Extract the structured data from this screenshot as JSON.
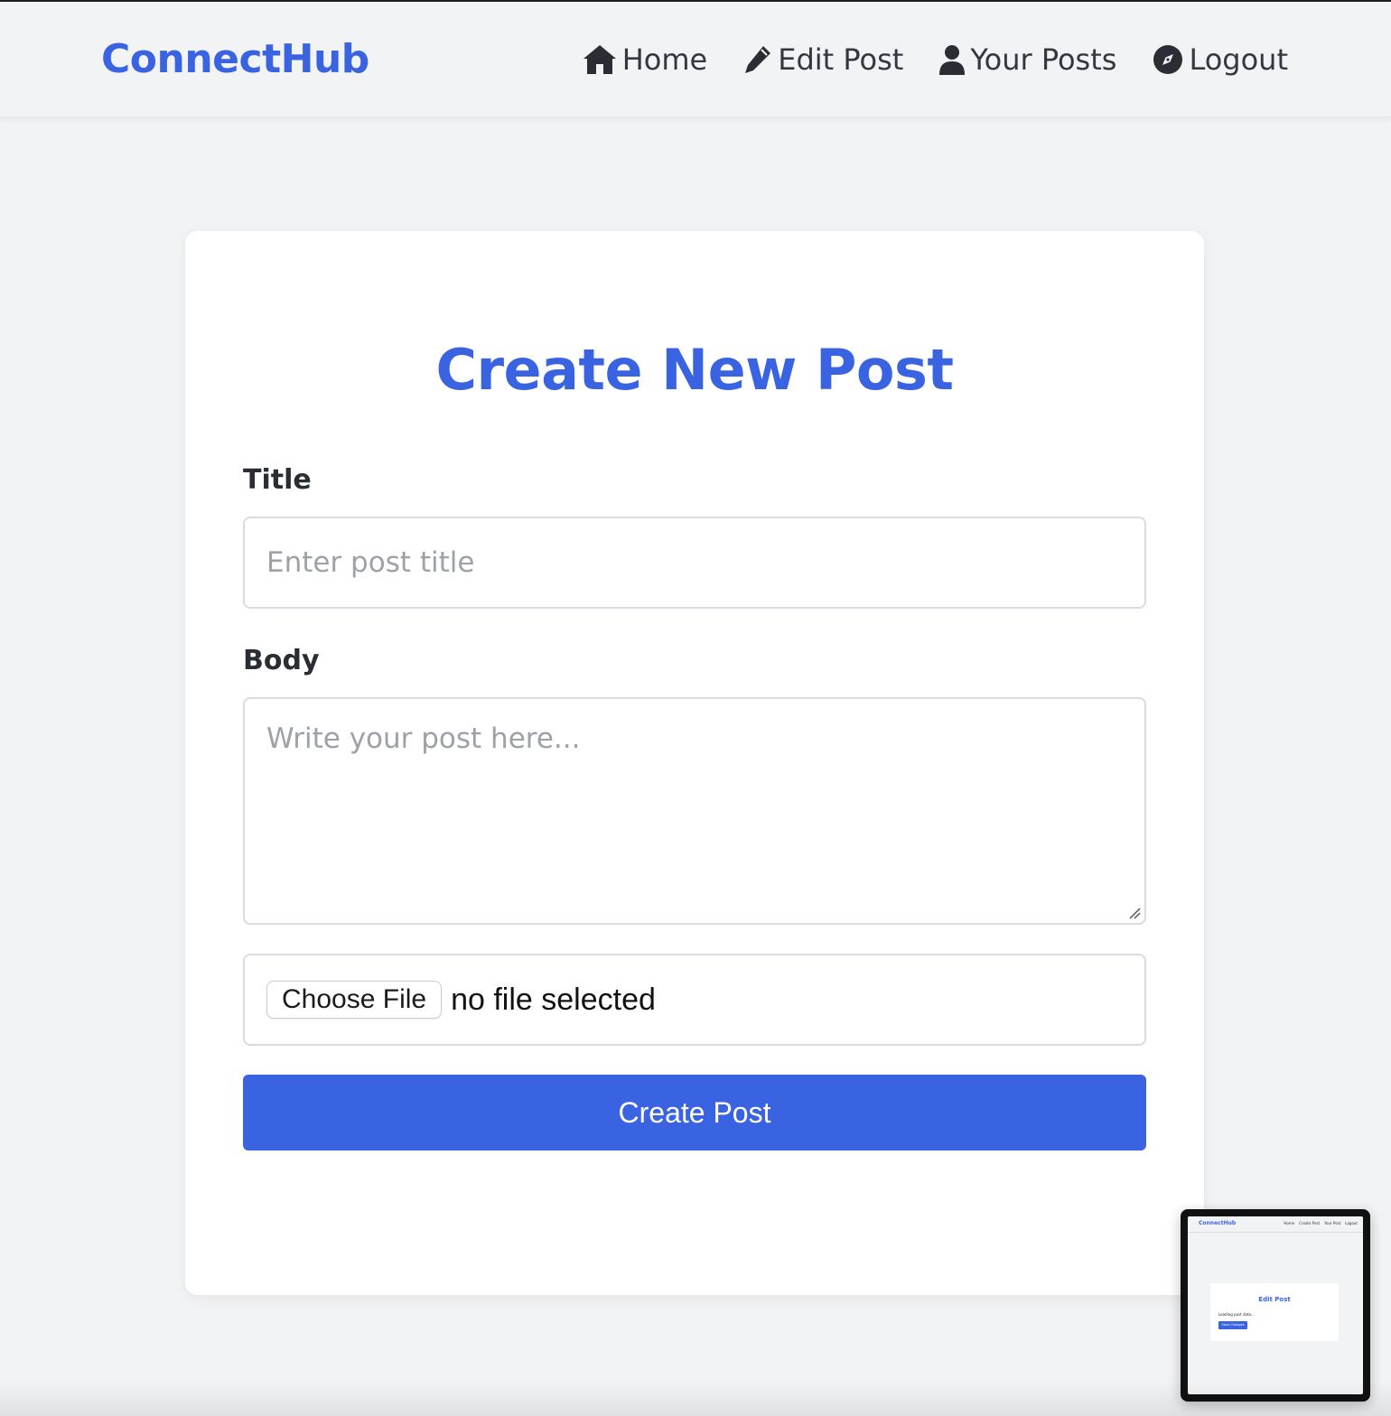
{
  "nav": {
    "brand": "ConnectHub",
    "links": [
      {
        "label": "Home",
        "icon": "home-icon"
      },
      {
        "label": "Edit Post",
        "icon": "pen-icon"
      },
      {
        "label": "Your Posts",
        "icon": "user-icon"
      },
      {
        "label": "Logout",
        "icon": "compass-icon"
      }
    ]
  },
  "form": {
    "heading": "Create New Post",
    "title_label": "Title",
    "title_placeholder": "Enter post title",
    "body_label": "Body",
    "body_placeholder": "Write your post here...",
    "file_button": "Choose File",
    "file_status": "no file selected",
    "submit_label": "Create Post"
  },
  "thumbnail": {
    "brand": "ConnectHub",
    "links": [
      "Home",
      "Create Post",
      "Your Post",
      "Logout"
    ],
    "title": "Edit Post",
    "loading_text": "Loading post data...",
    "button_label": "Save Changes"
  },
  "colors": {
    "accent": "#3a63e2",
    "background": "#f2f3f5",
    "text": "#333740"
  }
}
